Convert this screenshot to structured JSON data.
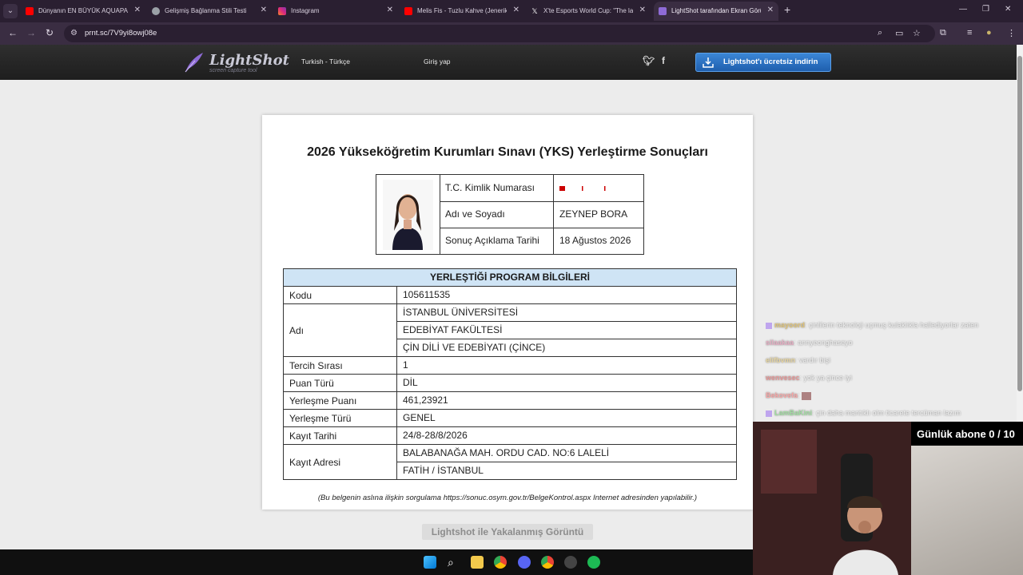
{
  "browser": {
    "tabs": [
      {
        "title": "Dünyanın EN BÜYÜK AQUAPARK",
        "favicon": "youtube-icon",
        "color": "#ff0000"
      },
      {
        "title": "Gelişmiş Bağlanma Stili Testi",
        "favicon": "globe-icon",
        "color": "#9aa0a6"
      },
      {
        "title": "Instagram",
        "favicon": "instagram-icon",
        "color": "#e1306c"
      },
      {
        "title": "Melis Fis - Tuzlu Kahve (Jenerik",
        "favicon": "youtube-icon",
        "color": "#ff0000"
      },
      {
        "title": "X'te Esports World Cup: \"The la",
        "favicon": "x-icon",
        "color": "#ffffff"
      },
      {
        "title": "LightShot tarafından Ekran Görü",
        "favicon": "lightshot-icon",
        "color": "#8e6bd6",
        "active": true
      }
    ],
    "url": "prnt.sc/7V9yi8owj08e"
  },
  "lightshot": {
    "logo_text": "LightShot",
    "logo_sub": "screen capture tool",
    "language": "Turkish - Türkçe",
    "login": "Giriş yap",
    "download": "Lightshot'ı ücretsiz indirin",
    "caption": "Lightshot ile Yakalanmış Görüntü"
  },
  "document": {
    "title": "2026 Yükseköğretim Kurumları Sınavı (YKS) Yerleştirme Sonuçları",
    "info": [
      {
        "key": "T.C. Kimlik Numarası",
        "value": "",
        "redacted": true
      },
      {
        "key": "Adı ve Soyadı",
        "value": "ZEYNEP BORA"
      },
      {
        "key": "Sonuç Açıklama Tarihi",
        "value": "18 Ağustos 2026"
      }
    ],
    "program_header": "YERLEŞTİĞİ PROGRAM BİLGİLERİ",
    "program_rows": [
      {
        "key": "Kodu",
        "values": [
          "105611535"
        ]
      },
      {
        "key": "Adı",
        "values": [
          "İSTANBUL ÜNİVERSİTESİ",
          "EDEBİYAT FAKÜLTESİ",
          "ÇİN DİLİ VE EDEBİYATI (ÇİNCE)"
        ]
      },
      {
        "key": "Tercih Sırası",
        "values": [
          "1"
        ]
      },
      {
        "key": "Puan Türü",
        "values": [
          "DİL"
        ]
      },
      {
        "key": "Yerleşme Puanı",
        "values": [
          "461,23921"
        ]
      },
      {
        "key": "Yerleşme Türü",
        "values": [
          "GENEL"
        ]
      },
      {
        "key": "Kayıt Tarihi",
        "values": [
          "24/8-28/8/2026"
        ]
      },
      {
        "key": "Kayıt Adresi",
        "values": [
          "BALABANAĞA MAH. ORDU CAD. NO:6 LALELİ",
          "FATİH / İSTANBUL"
        ]
      }
    ],
    "footer": "(Bu belgenin aslına ilişkin sorgulama https://sonuc.osym.gov.tr/BelgeKontrol.aspx Internet adresinden yapılabilir.)"
  },
  "chat": [
    {
      "user": "mayoord",
      "color": "#d4a017",
      "text": ": çinlilerin teknoloji uçmuş kulaklıkla hallediyorlar zaten",
      "badge": true
    },
    {
      "user": "silaakaa",
      "color": "#e07aa0",
      "text": ": annyeonghaseyo"
    },
    {
      "user": "elifbvmn",
      "color": "#e0c060",
      "text": ": vardır bişi"
    },
    {
      "user": "wenvesec",
      "color": "#e05050",
      "text": ": yok ya çince iyi"
    },
    {
      "user": "Bekovefa",
      "color": "#ff6a6a",
      "text": ":",
      "emote": true
    },
    {
      "user": "LamBaKini",
      "color": "#60d060",
      "text": ": çin daha mantıklı olm ticarete tercüman lazım",
      "badge": true
    }
  ],
  "stream": {
    "sub_goal": "Günlük abone 0 / 10"
  }
}
